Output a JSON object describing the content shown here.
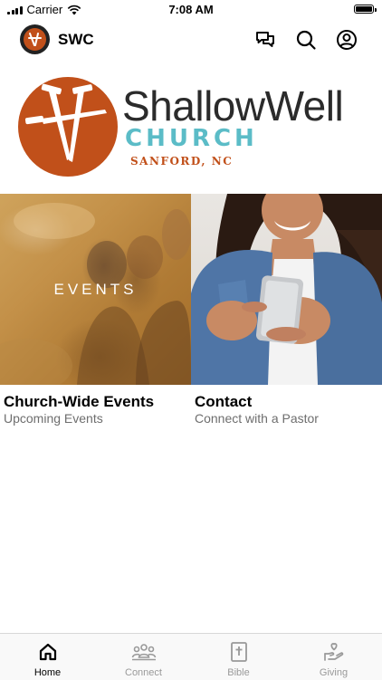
{
  "status_bar": {
    "carrier": "Carrier",
    "time": "7:08 AM",
    "battery_level": 1.0
  },
  "header": {
    "title": "SWC",
    "icons": [
      "chat-icon",
      "search-icon",
      "profile-icon"
    ]
  },
  "logo": {
    "name": "ShallowWell",
    "church": "CHURCH",
    "location": "SANFORD, NC",
    "colors": {
      "brand_orange": "#c1501a",
      "church_teal": "#5bbcc7",
      "name_dark": "#2b2b2b"
    }
  },
  "cards": [
    {
      "overlay": "EVENTS",
      "title": "Church-Wide Events",
      "subtitle": "Upcoming Events"
    },
    {
      "title": "Contact",
      "subtitle": "Connect with a Pastor"
    }
  ],
  "tabbar": {
    "tabs": [
      {
        "label": "Home",
        "icon": "home-icon",
        "active": true
      },
      {
        "label": "Connect",
        "icon": "people-icon",
        "active": false
      },
      {
        "label": "Bible",
        "icon": "bible-icon",
        "active": false
      },
      {
        "label": "Giving",
        "icon": "giving-hand-icon",
        "active": false
      }
    ]
  }
}
